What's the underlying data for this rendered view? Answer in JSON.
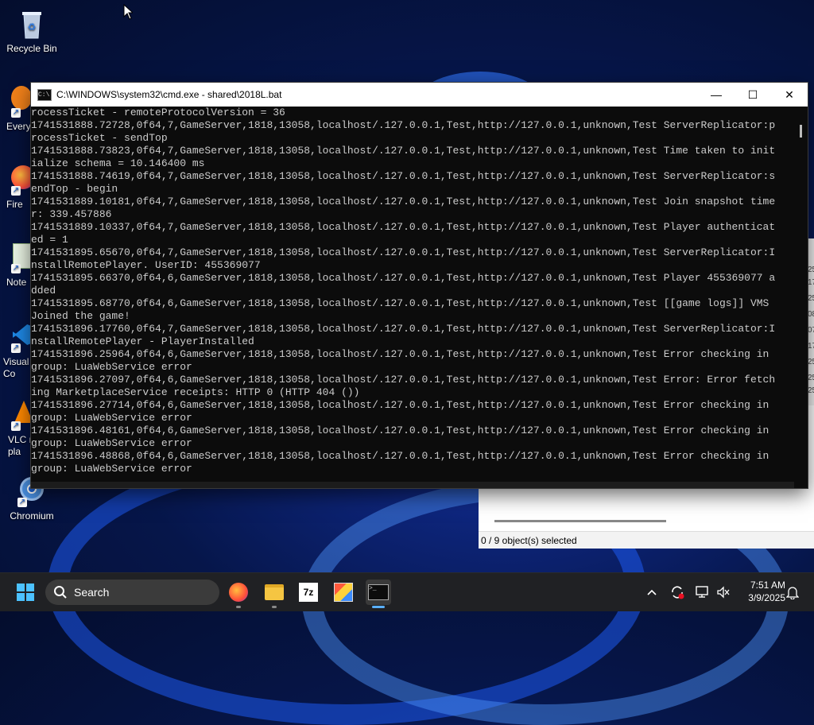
{
  "desktop": {
    "icons": [
      {
        "label": "Recycle Bin"
      },
      {
        "label": "Every"
      },
      {
        "label": "Fire"
      },
      {
        "label": "Note"
      },
      {
        "label": "Visual\nCo"
      },
      {
        "label": "VLC r\npla"
      },
      {
        "label": "Chromium"
      }
    ]
  },
  "explorer": {
    "status": "0 / 9 object(s) selected",
    "strip_digits": [
      "25",
      "17",
      "25",
      "08",
      "07",
      "17",
      "25",
      "25",
      "25"
    ]
  },
  "cmd": {
    "title": "C:\\WINDOWS\\system32\\cmd.exe - shared\\2018L.bat",
    "controls": {
      "minimize": "—",
      "maximize": "☐",
      "close": "✕"
    },
    "lines": [
      "rocessTicket - remoteProtocolVersion = 36",
      "1741531888.72728,0f64,7,GameServer,1818,13058,localhost/.127.0.0.1,Test,http://127.0.0.1,unknown,Test ServerReplicator:p",
      "rocessTicket - sendTop",
      "1741531888.73823,0f64,7,GameServer,1818,13058,localhost/.127.0.0.1,Test,http://127.0.0.1,unknown,Test Time taken to init",
      "ialize schema = 10.146400 ms",
      "1741531888.74619,0f64,7,GameServer,1818,13058,localhost/.127.0.0.1,Test,http://127.0.0.1,unknown,Test ServerReplicator:s",
      "endTop - begin",
      "1741531889.10181,0f64,7,GameServer,1818,13058,localhost/.127.0.0.1,Test,http://127.0.0.1,unknown,Test Join snapshot time",
      "r: 339.457886",
      "1741531889.10337,0f64,7,GameServer,1818,13058,localhost/.127.0.0.1,Test,http://127.0.0.1,unknown,Test Player authenticat",
      "ed = 1",
      "1741531895.65670,0f64,7,GameServer,1818,13058,localhost/.127.0.0.1,Test,http://127.0.0.1,unknown,Test ServerReplicator:I",
      "nstallRemotePlayer. UserID: 455369077",
      "1741531895.66370,0f64,6,GameServer,1818,13058,localhost/.127.0.0.1,Test,http://127.0.0.1,unknown,Test Player 455369077 a",
      "dded",
      "1741531895.68770,0f64,6,GameServer,1818,13058,localhost/.127.0.0.1,Test,http://127.0.0.1,unknown,Test [[game logs]] VMS",
      "Joined the game!",
      "1741531896.17760,0f64,7,GameServer,1818,13058,localhost/.127.0.0.1,Test,http://127.0.0.1,unknown,Test ServerReplicator:I",
      "nstallRemotePlayer - PlayerInstalled",
      "1741531896.25964,0f64,6,GameServer,1818,13058,localhost/.127.0.0.1,Test,http://127.0.0.1,unknown,Test Error checking in",
      "group: LuaWebService error",
      "1741531896.27097,0f64,6,GameServer,1818,13058,localhost/.127.0.0.1,Test,http://127.0.0.1,unknown,Test Error: Error fetch",
      "ing MarketplaceService receipts: HTTP 0 (HTTP 404 ())",
      "1741531896.27714,0f64,6,GameServer,1818,13058,localhost/.127.0.0.1,Test,http://127.0.0.1,unknown,Test Error checking in",
      "group: LuaWebService error",
      "1741531896.48161,0f64,6,GameServer,1818,13058,localhost/.127.0.0.1,Test,http://127.0.0.1,unknown,Test Error checking in",
      "group: LuaWebService error",
      "1741531896.48868,0f64,6,GameServer,1818,13058,localhost/.127.0.0.1,Test,http://127.0.0.1,unknown,Test Error checking in",
      "group: LuaWebService error"
    ]
  },
  "taskbar": {
    "search_label": "Search",
    "apps": [
      {
        "icon": "firefox-icon"
      },
      {
        "icon": "file-explorer-icon"
      },
      {
        "icon": "7zip-icon",
        "text": "7z"
      },
      {
        "icon": "paint-icon"
      },
      {
        "icon": "terminal-icon",
        "active": true
      }
    ],
    "time": "7:51 AM",
    "date": "3/9/2025"
  },
  "colors": {
    "console_bg": "#0c0c0c",
    "console_fg": "#cccccc",
    "accent": "#5ab0ff",
    "taskbar_bg": "#202124"
  }
}
